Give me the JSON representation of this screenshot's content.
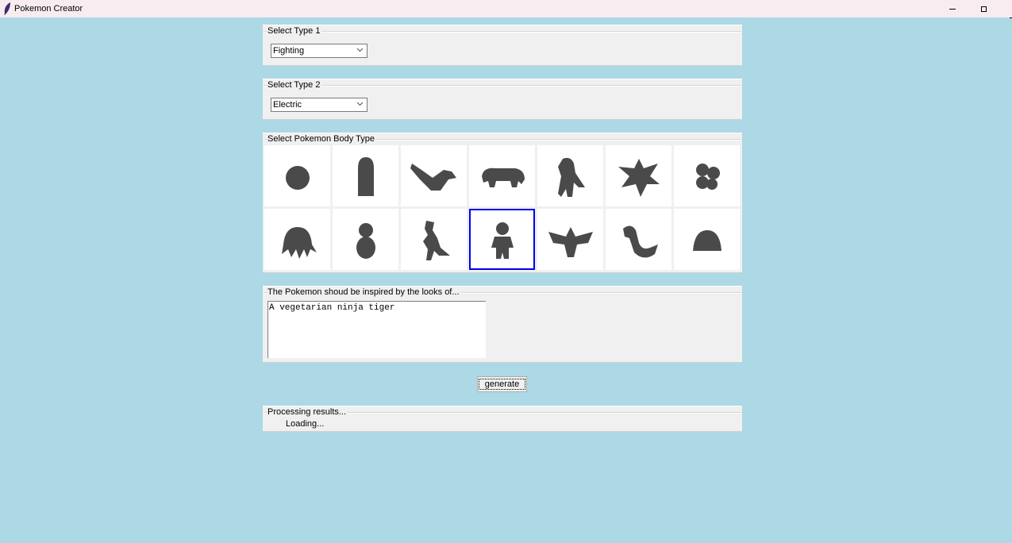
{
  "window": {
    "title": "Pokemon Creator",
    "icon": "feather-icon",
    "controls": [
      "minimize",
      "maximize"
    ]
  },
  "type1": {
    "legend": "Select Type 1",
    "selected": "Fighting"
  },
  "type2": {
    "legend": "Select Type 2",
    "selected": "Electric"
  },
  "body_type": {
    "legend": "Select Pokemon Body Type",
    "options": [
      "head-only",
      "serpentine-upright",
      "fish",
      "quadruped",
      "bipedal-tailed",
      "multiple-wings",
      "multiple-bodies",
      "tentacles",
      "head-and-body",
      "bipedal-tailless",
      "head-and-legs",
      "single-pair-wings",
      "serpentine",
      "head-and-base"
    ],
    "selected_index": 10
  },
  "inspiration": {
    "legend": "The Pokemon shoud be inspired by the looks of...",
    "text": "A vegetarian ninja tiger"
  },
  "generate": {
    "label": "generate"
  },
  "results": {
    "legend": "Processing results...",
    "status": "Loading..."
  },
  "colors": {
    "background": "#add8e6",
    "selection": "#0000ee",
    "silhouette": "#4a4a4a"
  }
}
